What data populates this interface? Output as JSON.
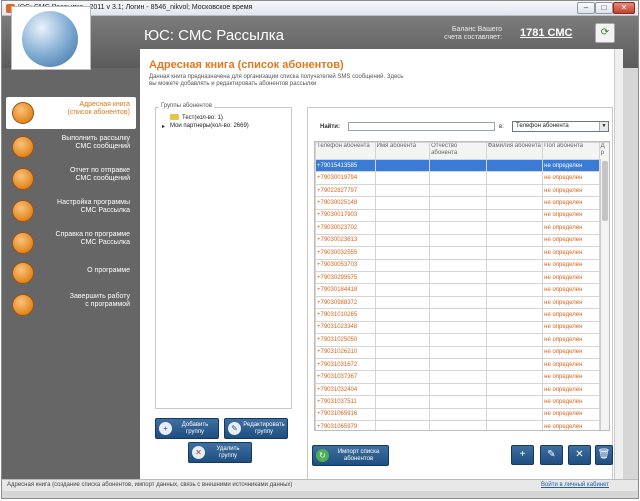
{
  "window": {
    "title": "ЮС: СМС Рассылка - 2011 v 3.1; Логин - 8546_nikvol; Московское время"
  },
  "header": {
    "app_title": "ЮС: СМС Рассылка",
    "balance_label_line1": "Баланс Вашего",
    "balance_label_line2": "счета составляет:",
    "balance_value": "1781 СМС"
  },
  "sidebar": {
    "items": [
      {
        "label_line1": "Адресная книга",
        "label_line2": "(список абонентов)",
        "active": true
      },
      {
        "label_line1": "Выполнить рассылку",
        "label_line2": "СМС сообщений",
        "active": false
      },
      {
        "label_line1": "Отчет по отправке",
        "label_line2": "СМС сообщений",
        "active": false
      },
      {
        "label_line1": "Настройка программы",
        "label_line2": "СМС Рассылка",
        "active": false
      },
      {
        "label_line1": "Справка по программе",
        "label_line2": "СМС Рассылка",
        "active": false
      },
      {
        "label_line1": "О программе",
        "label_line2": "",
        "active": false
      },
      {
        "label_line1": "Завершить работу",
        "label_line2": "с программой",
        "active": false
      }
    ]
  },
  "page": {
    "title": "Адресная книга (список абонентов)",
    "desc_line1": "Данная книга предназначена для организации списка получателей SMS сообщений. Здесь",
    "desc_line2": "вы можете добавлять и редактировать абонентов рассылки"
  },
  "groups": {
    "legend": "Группы абонентов",
    "items": [
      "Тест(кол-во: 1)",
      "Мои партнеры(кол-во: 2669)"
    ]
  },
  "search": {
    "label": "Найти:",
    "value": "",
    "in_label": "в:",
    "field_selected": "Телефон абонента"
  },
  "table": {
    "headers": [
      "Телефон абонента",
      "Имя абонента",
      "Отчество абонента",
      "Фамилия абонента",
      "Пол абонента",
      "Д р"
    ],
    "gender_value": "не определен",
    "phones": [
      "+79015413585",
      "+79030019794",
      "+79022827797",
      "+79030025148",
      "+79030017903",
      "+79030023702",
      "+79030023613",
      "+79030032555",
      "+79030053703",
      "+79030299575",
      "+79030184418",
      "+79030988372",
      "+79031010265",
      "+79031023348",
      "+79031025050",
      "+79031026210",
      "+79031031672",
      "+79031037367",
      "+79031032404",
      "+79031037511",
      "+79031065916",
      "+79031065979"
    ]
  },
  "buttons": {
    "add_group": "Добавить группу",
    "edit_group": "Редактировать группу",
    "delete_group": "Удалить группу",
    "import_list": "Импорт списка абонентов"
  },
  "statusbar": {
    "text": "Адресная книга (создание списка абонентов, импорт данных, связь с внешними источниками данных)",
    "link": "Войти в личный кабинет"
  },
  "colors": {
    "accent_orange": "#e07a1e",
    "selection_blue": "#3a7bd5",
    "button_blue": "#2a5a8a"
  }
}
